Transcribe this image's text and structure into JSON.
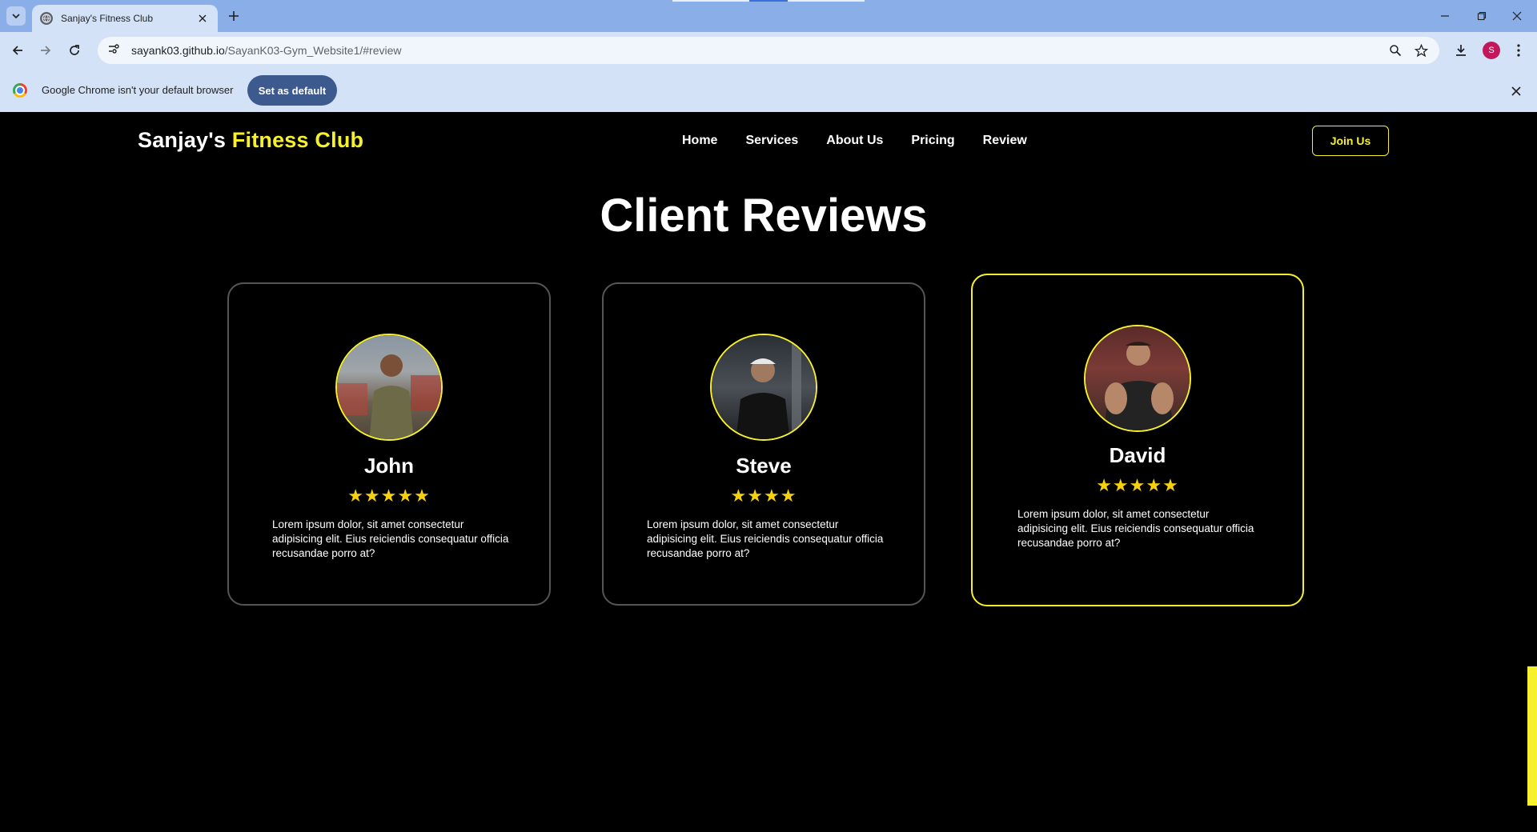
{
  "browser": {
    "tab_title": "Sanjay's Fitness Club",
    "url_host": "sayank03.github.io",
    "url_path": "/SayanK03-Gym_Website1/#review",
    "profile_initial": "S",
    "infobar_text": "Google Chrome isn't your default browser",
    "set_default_label": "Set as default"
  },
  "site": {
    "logo_main": "Sanjay's",
    "logo_accent": "Fitness Club",
    "nav": [
      "Home",
      "Services",
      "About Us",
      "Pricing",
      "Review"
    ],
    "join_label": "Join Us",
    "accent_color": "#f6f12c"
  },
  "reviews": {
    "title": "Client Reviews",
    "cards": [
      {
        "name": "John",
        "stars": "★★★★★",
        "rating": 5,
        "text": "Lorem ipsum dolor, sit amet consectetur adipisicing elit. Eius reiciendis consequatur officia recusandae porro at?"
      },
      {
        "name": "Steve",
        "stars": "★★★★",
        "rating": 4,
        "text": "Lorem ipsum dolor, sit amet consectetur adipisicing elit. Eius reiciendis consequatur officia recusandae porro at?"
      },
      {
        "name": "David",
        "stars": "★★★★★",
        "rating": 5,
        "text": "Lorem ipsum dolor, sit amet consectetur adipisicing elit. Eius reiciendis consequatur officia recusandae porro at?"
      }
    ]
  }
}
